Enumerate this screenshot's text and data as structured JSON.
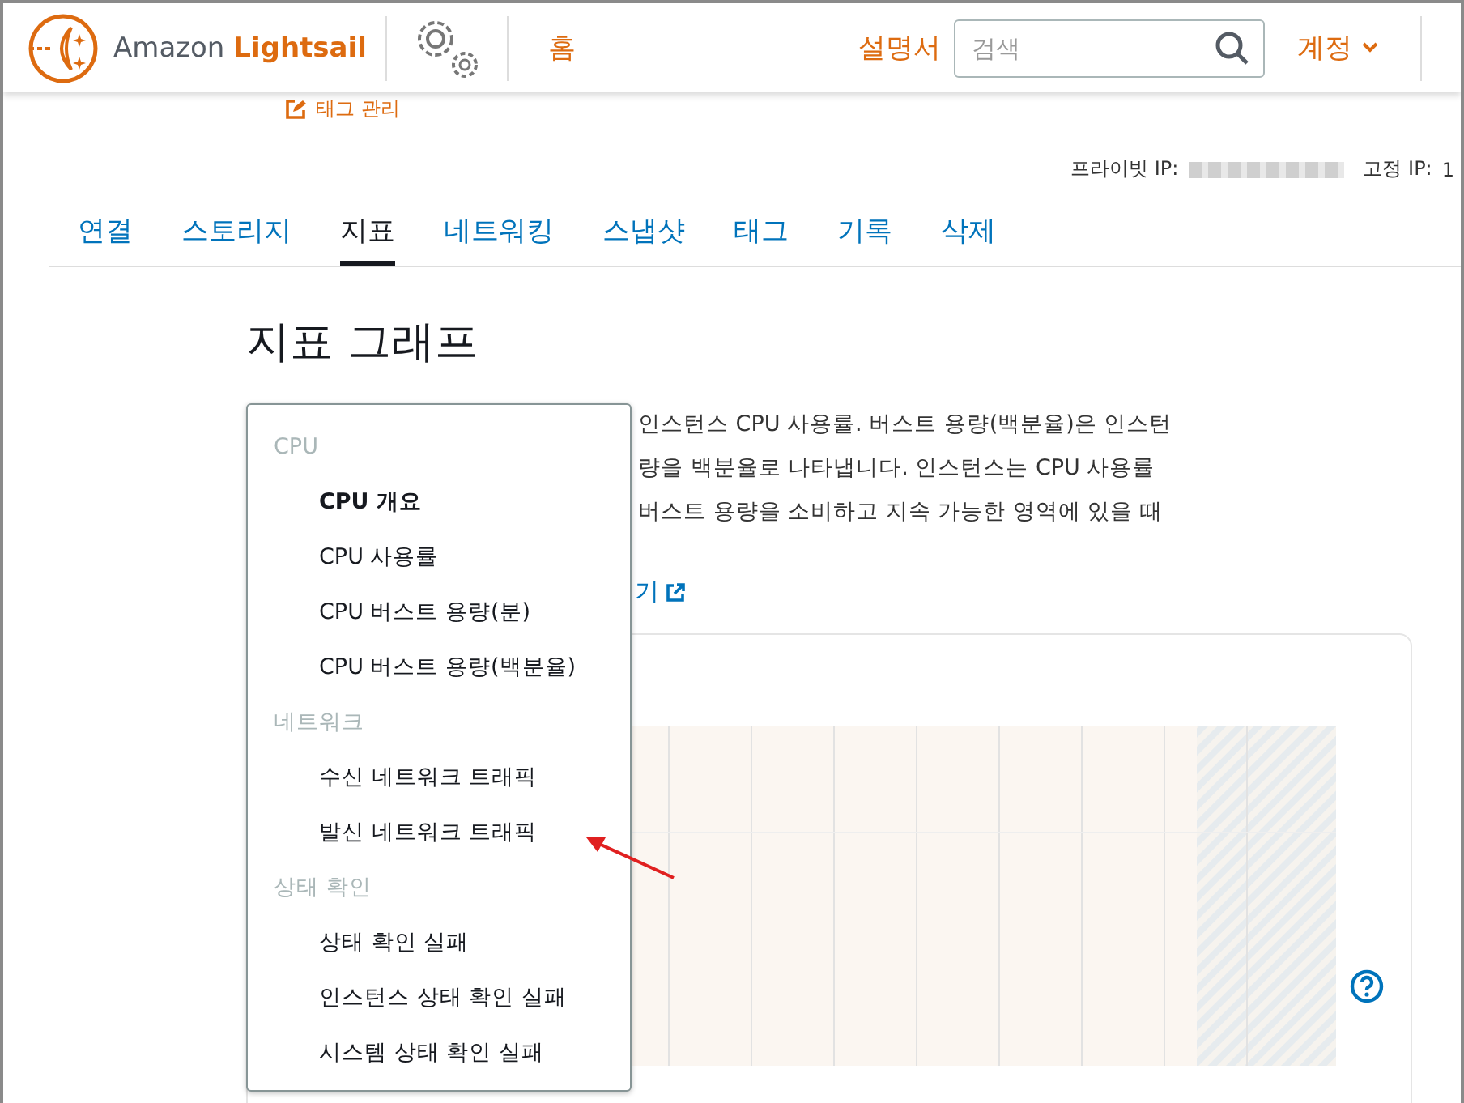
{
  "header": {
    "brand": {
      "name": "Amazon",
      "product": "Lightsail"
    },
    "nav": [
      {
        "label": "홈"
      }
    ],
    "docs_link": "설명서",
    "search": {
      "placeholder": "검색"
    },
    "account": "계정"
  },
  "tag_manage": "태그 관리",
  "ip_info": [
    {
      "label": "프라이빗 IP:",
      "blurred": true
    },
    {
      "label": "고정 IP:",
      "value": "1"
    }
  ],
  "tabs": [
    {
      "label": "연결",
      "selected": false
    },
    {
      "label": "스토리지",
      "selected": false
    },
    {
      "label": "지표",
      "selected": true
    },
    {
      "label": "네트워킹",
      "selected": false
    },
    {
      "label": "스냅샷",
      "selected": false
    },
    {
      "label": "태그",
      "selected": false
    },
    {
      "label": "기록",
      "selected": false
    },
    {
      "label": "삭제",
      "selected": false
    }
  ],
  "section_title": "지표 그래프",
  "description_lines": [
    "인스턴스 CPU 사용률. 버스트 용량(백분율)은 인스턴",
    "량을 백분율로 나타냅니다. 인스턴스는 CPU 사용률",
    "버스트 용량을 소비하고 지속 가능한 영역에 있을 때"
  ],
  "learn_more_link": "기",
  "metric_menu": [
    {
      "kind": "group",
      "label": "CPU"
    },
    {
      "kind": "option",
      "label": "CPU 개요",
      "selected": true
    },
    {
      "kind": "option",
      "label": "CPU 사용률",
      "selected": false
    },
    {
      "kind": "option",
      "label": "CPU 버스트 용량(분)",
      "selected": false
    },
    {
      "kind": "option",
      "label": "CPU 버스트 용량(백분율)",
      "selected": false
    },
    {
      "kind": "group",
      "label": "네트워크"
    },
    {
      "kind": "option",
      "label": "수신 네트워크 트래픽",
      "selected": false
    },
    {
      "kind": "option",
      "label": "발신 네트워크 트래픽",
      "selected": false
    },
    {
      "kind": "group",
      "label": "상태 확인"
    },
    {
      "kind": "option",
      "label": "상태 확인 실패",
      "selected": false
    },
    {
      "kind": "option",
      "label": "인스턴스 상태 확인 실패",
      "selected": false
    },
    {
      "kind": "option",
      "label": "시스템 상태 확인 실패",
      "selected": false
    }
  ]
}
